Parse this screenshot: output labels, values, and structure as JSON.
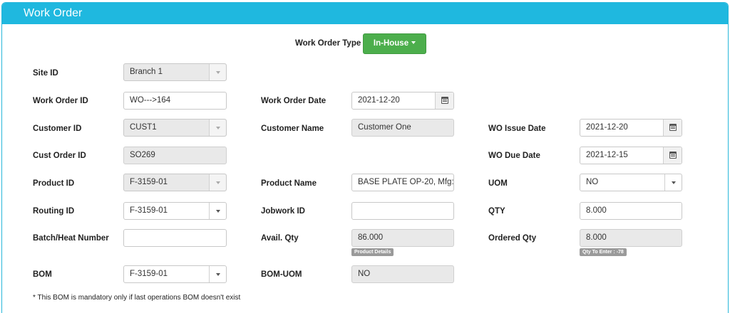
{
  "header": {
    "title": "Work Order"
  },
  "work_order_type": {
    "label": "Work Order Type",
    "button": "In-House"
  },
  "fields": {
    "site_id": {
      "label": "Site ID",
      "value": "Branch 1"
    },
    "work_order_id": {
      "label": "Work Order ID",
      "value": "WO--->164"
    },
    "work_order_date": {
      "label": "Work Order Date",
      "value": "2021-12-20"
    },
    "customer_id": {
      "label": "Customer ID",
      "value": "CUST1"
    },
    "customer_name": {
      "label": "Customer Name",
      "value": "Customer One"
    },
    "wo_issue_date": {
      "label": "WO Issue Date",
      "value": "2021-12-20"
    },
    "cust_order_id": {
      "label": "Cust Order ID",
      "value": "SO269"
    },
    "wo_due_date": {
      "label": "WO Due Date",
      "value": "2021-12-15"
    },
    "product_id": {
      "label": "Product ID",
      "value": "F-3159-01"
    },
    "product_name": {
      "label": "Product Name",
      "value": "BASE PLATE OP-20, Mfg:"
    },
    "uom": {
      "label": "UOM",
      "value": "NO"
    },
    "routing_id": {
      "label": "Routing ID",
      "value": "F-3159-01"
    },
    "jobwork_id": {
      "label": "Jobwork ID",
      "value": ""
    },
    "qty": {
      "label": "QTY",
      "value": "8.000"
    },
    "batch_heat_number": {
      "label": "Batch/Heat Number",
      "value": ""
    },
    "avail_qty": {
      "label": "Avail. Qty",
      "value": "86.000",
      "badge": "Product Details"
    },
    "ordered_qty": {
      "label": "Ordered Qty",
      "value": "8.000",
      "badge": "Qty To Enter : -78"
    },
    "bom": {
      "label": "BOM",
      "value": "F-3159-01"
    },
    "bom_uom": {
      "label": "BOM-UOM",
      "value": "NO"
    }
  },
  "note": "* This BOM is mandatory only if last operations BOM doesn't exist",
  "colors": {
    "header": "#1fb8df",
    "button": "#4cae4c"
  }
}
